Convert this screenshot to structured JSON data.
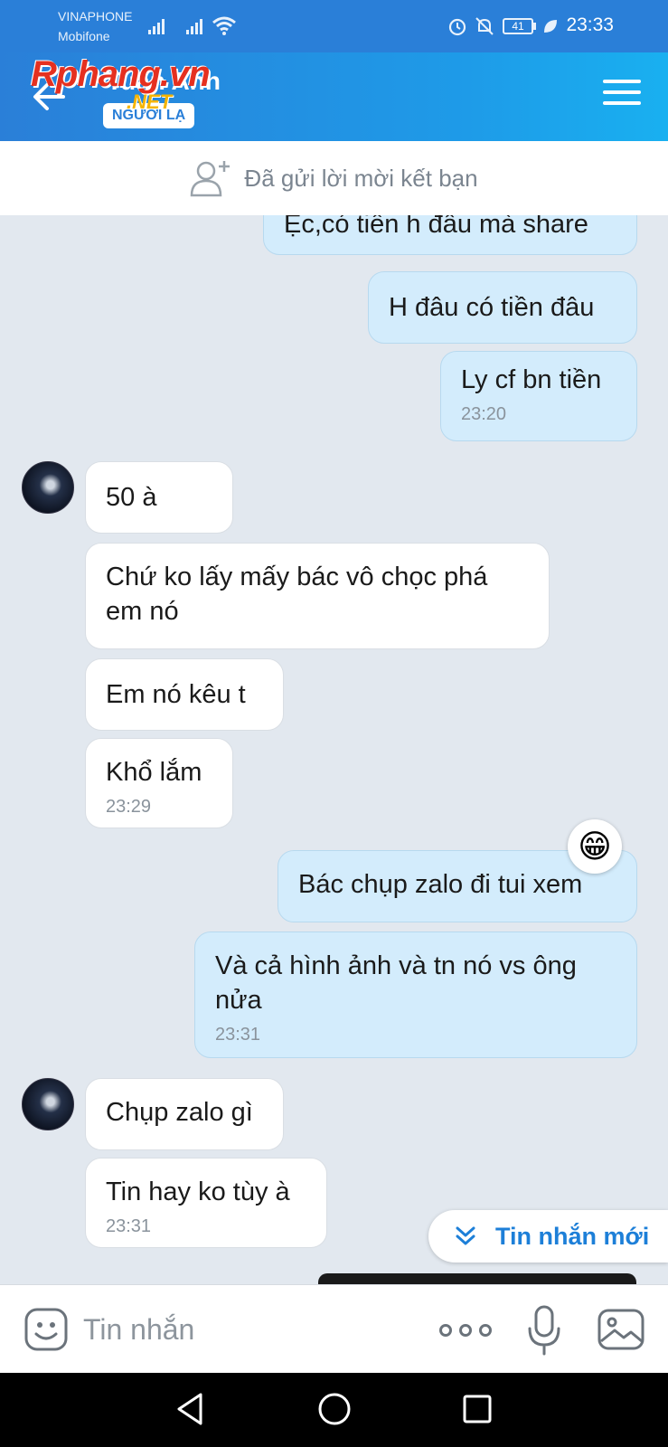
{
  "status_bar": {
    "carrier_1": "VINAPHONE",
    "carrier_2": "Mobifone",
    "battery": "41",
    "time": "23:33"
  },
  "header": {
    "contact_name": "Tuấn Anh",
    "badge": "NGƯỜI LẠ",
    "watermark": "Rphang.vn",
    "watermark_suffix": ".NET",
    "accent_color": "#2a7fd8"
  },
  "friend_request": {
    "label": "Đã gửi lời mời kết bạn"
  },
  "messages": [
    {
      "text": "Ẹc,có tiền h đâu mà share",
      "direction": "sent"
    },
    {
      "text": "H đâu có tiền đâu",
      "direction": "sent"
    },
    {
      "text": "Ly cf bn tiền",
      "direction": "sent",
      "time": "23:20"
    },
    {
      "text": "50 à",
      "direction": "received"
    },
    {
      "text": "Chứ ko lấy mấy bác vô chọc phá em nó",
      "direction": "received"
    },
    {
      "text": "Em nó kêu t",
      "direction": "received"
    },
    {
      "text": "Khổ lắm",
      "direction": "received",
      "time": "23:29"
    },
    {
      "text": "Bác chụp zalo đi tui xem",
      "direction": "sent",
      "reaction": "😁"
    },
    {
      "text": "Và cả hình ảnh và tn nó vs ông nửa",
      "direction": "sent",
      "time": "23:31"
    },
    {
      "text": "Chụp zalo gì",
      "direction": "received"
    },
    {
      "text": "Tin hay ko tùy à",
      "direction": "received",
      "time": "23:31"
    }
  ],
  "new_message_button": {
    "label": "Tin nhắn mới"
  },
  "composer": {
    "placeholder": "Tin nhắn"
  }
}
